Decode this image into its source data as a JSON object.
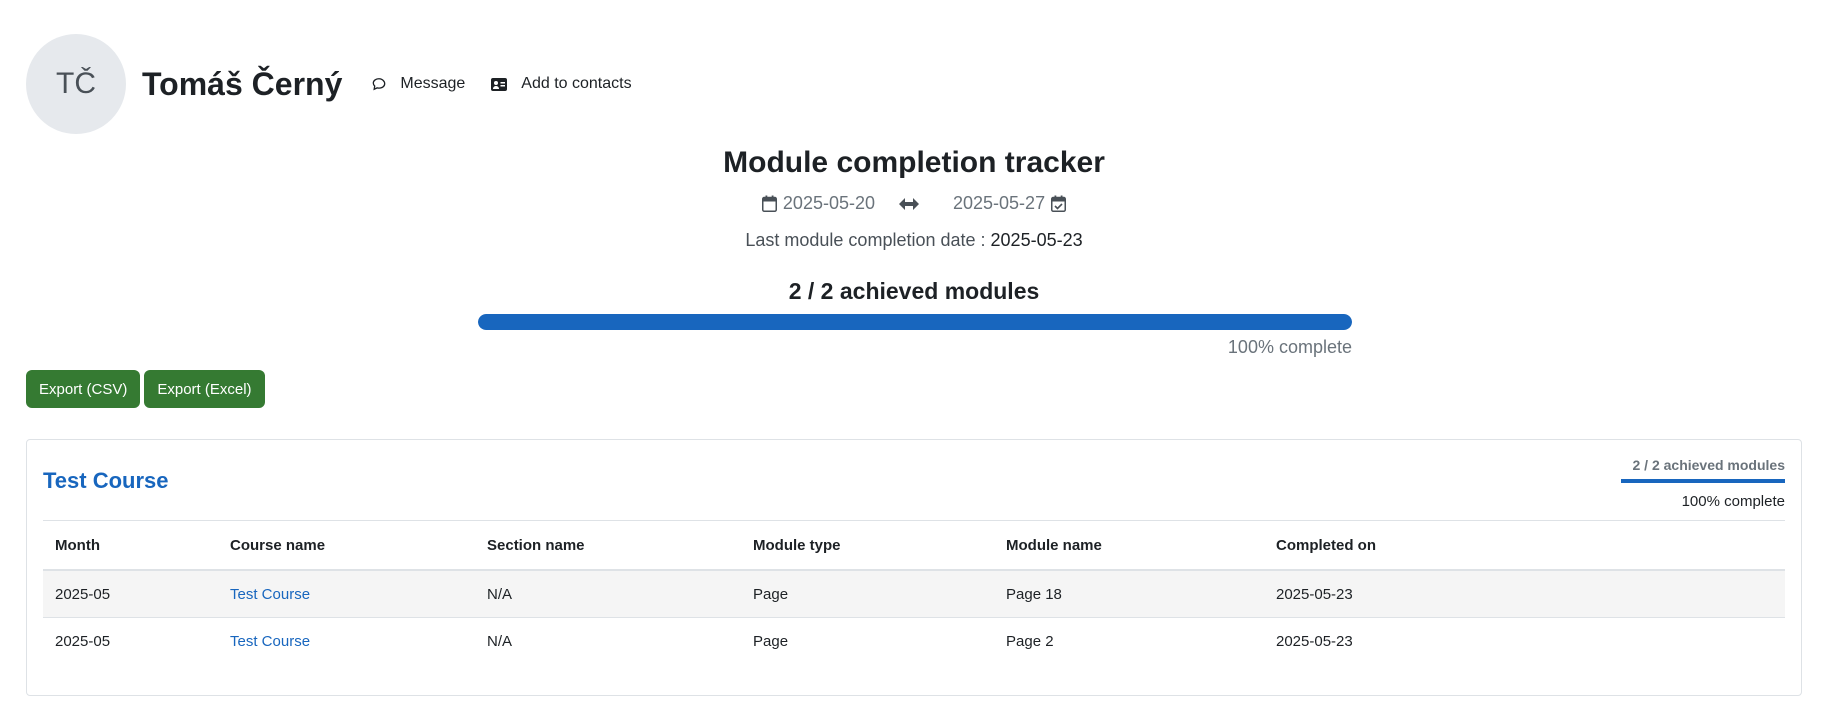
{
  "user": {
    "initials": "TČ",
    "name": "Tomáš Černý",
    "actions": {
      "message": "Message",
      "add_contacts": "Add to contacts"
    }
  },
  "tracker": {
    "title": "Module completion tracker",
    "date_from": "2025-05-20",
    "date_to": "2025-05-27",
    "last_completion_label": "Last module completion date : ",
    "last_completion_value": "2025-05-23",
    "achieved_text": "2 / 2 achieved modules",
    "progress_percent": 100,
    "progress_text": "100% complete"
  },
  "exports": {
    "csv": "Export (CSV)",
    "excel": "Export (Excel)"
  },
  "course": {
    "title": "Test Course",
    "achieved_text": "2 / 2 achieved modules",
    "progress_percent": 100,
    "progress_text": "100% complete",
    "columns": [
      "Month",
      "Course name",
      "Section name",
      "Module type",
      "Module name",
      "Completed on"
    ],
    "rows": [
      [
        "2025-05",
        "Test Course",
        "N/A",
        "Page",
        "Page 18",
        "2025-05-23"
      ],
      [
        "2025-05",
        "Test Course",
        "N/A",
        "Page",
        "Page 2",
        "2025-05-23"
      ]
    ]
  },
  "icons": {
    "message": "speech-bubble-icon",
    "contacts": "address-card-icon",
    "date_from": "calendar-icon",
    "range": "double-arrow-icon",
    "date_to": "calendar-check-icon"
  },
  "colors": {
    "accent": "#1866be",
    "export_button": "#357a32",
    "avatar_bg": "#e6e9ed"
  }
}
